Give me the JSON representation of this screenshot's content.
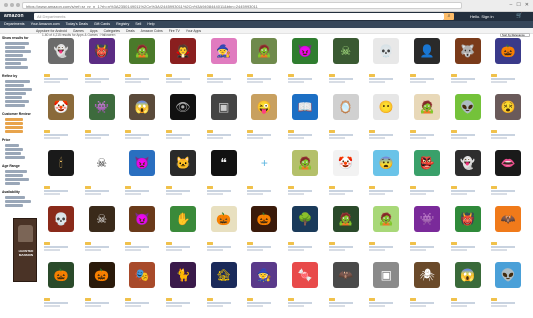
{
  "browser": {
    "url": "https://www.amazon.com/s/ref=sr_nr_n_1?rh=n%3A2350149011%2Cn%3A!2445993011%2Cn%3A9408444011&bbn=2445993011",
    "controls": [
      "–",
      "☐",
      "✕"
    ]
  },
  "header": {
    "logo": "amazon",
    "search_placeholder": "All Departments",
    "search_icon": "search-icon",
    "account": "Hello. Sign in",
    "cart_icon": "cart-icon",
    "cart_glyph": "🛒"
  },
  "nav": [
    "Departments",
    "Your Amazon.com",
    "Today's Deals",
    "Gift Cards",
    "Registry",
    "Sell",
    "Help"
  ],
  "subnav": [
    "Appstore for Android",
    "Games",
    "Apps",
    "Categories",
    "Deals",
    "Amazon Coins",
    "Fire TV",
    "Your Apps"
  ],
  "sidebar": {
    "headings": [
      "Show results for",
      "Refine by",
      "Customer Review",
      "Price",
      "Age Range",
      "Availability"
    ]
  },
  "promo": {
    "text": "HAUNTED MANSION"
  },
  "results": {
    "count": "1-60 of 4,215 results for Apps & Games : Halloween",
    "sort": "Sort by Relevance"
  },
  "colors": {
    "nav_dark": "#232f3e",
    "nav_mid": "#37475a",
    "search_button": "#febd69",
    "link": "#1a5db5"
  },
  "apps": [
    {
      "icon_name": "ghost-icon",
      "glyph": "👻",
      "bg": "#6b6b6b",
      "fg": "#ffffff"
    },
    {
      "icon_name": "monster-icon",
      "glyph": "👹",
      "bg": "#5b2c83",
      "fg": "#ffdd55"
    },
    {
      "icon_name": "frankenstein-icon",
      "glyph": "🧟",
      "bg": "#4a7a2a",
      "fg": "#cfeec0"
    },
    {
      "icon_name": "vampire-icon",
      "glyph": "🧛",
      "bg": "#8a1f1f",
      "fg": "#ffffff"
    },
    {
      "icon_name": "witch-icon",
      "glyph": "🧙",
      "bg": "#e07bbf",
      "fg": "#222222"
    },
    {
      "icon_name": "zombie-icon",
      "glyph": "🧟",
      "bg": "#6f8a4c",
      "fg": "#ffffff"
    },
    {
      "icon_name": "monster-face-icon",
      "glyph": "😈",
      "bg": "#2f7d2f",
      "fg": "#ffe066"
    },
    {
      "icon_name": "frankenstein-face-icon",
      "glyph": "☠",
      "bg": "#3a5a32",
      "fg": "#b4f08a"
    },
    {
      "icon_name": "skull-portrait-icon",
      "glyph": "💀",
      "bg": "#e8e8e8",
      "fg": "#222222"
    },
    {
      "icon_name": "ghost-shadow-icon",
      "glyph": "👤",
      "bg": "#2a2a2a",
      "fg": "#bbbbbb"
    },
    {
      "icon_name": "werewolf-icon",
      "glyph": "🐺",
      "bg": "#7a3b1a",
      "fg": "#ffd9a0"
    },
    {
      "icon_name": "pumpkin-field-icon",
      "glyph": "🎃",
      "bg": "#3a3a8a",
      "fg": "#ffb000"
    },
    {
      "icon_name": "scarecrow-icon",
      "glyph": "🤡",
      "bg": "#8a6a3a",
      "fg": "#ffffff"
    },
    {
      "icon_name": "creature-icon",
      "glyph": "👾",
      "bg": "#3d6b3d",
      "fg": "#ffffff"
    },
    {
      "icon_name": "haunted-man-icon",
      "glyph": "😱",
      "bg": "#5a4a3a",
      "fg": "#ffffff"
    },
    {
      "icon_name": "dark-figure-icon",
      "glyph": "👁",
      "bg": "#111111",
      "fg": "#aaaaaa"
    },
    {
      "icon_name": "photo-frame-icon",
      "glyph": "▣",
      "bg": "#444444",
      "fg": "#cccccc"
    },
    {
      "icon_name": "cartoon-face-icon",
      "glyph": "😜",
      "bg": "#c8a060",
      "fg": "#333333"
    },
    {
      "icon_name": "book-icon",
      "glyph": "📖",
      "bg": "#1c6fc4",
      "fg": "#ffffff"
    },
    {
      "icon_name": "mirror-icon",
      "glyph": "🪞",
      "bg": "#d0d0d0",
      "fg": "#555555"
    },
    {
      "icon_name": "face-icon",
      "glyph": "😶",
      "bg": "#e6e6e6",
      "fg": "#444444"
    },
    {
      "icon_name": "mummy-icon",
      "glyph": "🧟",
      "bg": "#e8d8b8",
      "fg": "#555555"
    },
    {
      "icon_name": "cartoon-monster-icon",
      "glyph": "👽",
      "bg": "#74c23a",
      "fg": "#ffffff"
    },
    {
      "icon_name": "ghoul-icon",
      "glyph": "😵",
      "bg": "#6a5a5a",
      "fg": "#ffffff"
    },
    {
      "icon_name": "candle-icon",
      "glyph": "🕯",
      "bg": "#1a1a1a",
      "fg": "#ffcc66"
    },
    {
      "icon_name": "skull-icon",
      "glyph": "☠",
      "bg": "#ffffff",
      "fg": "#222222"
    },
    {
      "icon_name": "blue-monster-icon",
      "glyph": "👿",
      "bg": "#2a6fc0",
      "fg": "#ffffff"
    },
    {
      "icon_name": "cat-icon",
      "glyph": "🐱",
      "bg": "#2a2a2a",
      "fg": "#ff9900"
    },
    {
      "icon_name": "quote-text-icon",
      "glyph": "❝",
      "bg": "#111111",
      "fg": "#eeeeee"
    },
    {
      "icon_name": "plus-icon",
      "glyph": "+",
      "bg": "#ffffff",
      "fg": "#5cb6e0"
    },
    {
      "icon_name": "zombie-cartoon-icon",
      "glyph": "🧟",
      "bg": "#b4c06a",
      "fg": "#333333"
    },
    {
      "icon_name": "clown-icon",
      "glyph": "🤡",
      "bg": "#f2f2f2",
      "fg": "#d24a4a"
    },
    {
      "icon_name": "spooky-face-icon",
      "glyph": "😨",
      "bg": "#6ac3e8",
      "fg": "#ffffff"
    },
    {
      "icon_name": "green-ghoul-icon",
      "glyph": "👺",
      "bg": "#3aa06a",
      "fg": "#ffffff"
    },
    {
      "icon_name": "sticker-monster-icon",
      "glyph": "👻",
      "bg": "#2d2d2d",
      "fg": "#ffffff"
    },
    {
      "icon_name": "lips-icon",
      "glyph": "👄",
      "bg": "#1a1a1a",
      "fg": "#ff3344"
    },
    {
      "icon_name": "skull-red-icon",
      "glyph": "💀",
      "bg": "#8a2a1a",
      "fg": "#ffddaa"
    },
    {
      "icon_name": "skull-dark-icon",
      "glyph": "☠",
      "bg": "#3a2a1a",
      "fg": "#eeeeee"
    },
    {
      "icon_name": "demon-face-icon",
      "glyph": "😈",
      "bg": "#6a3a1a",
      "fg": "#ffcc88"
    },
    {
      "icon_name": "hand-icon",
      "glyph": "✋",
      "bg": "#3a8a3a",
      "fg": "#ffffff"
    },
    {
      "icon_name": "pumpkin-cartoon-icon",
      "glyph": "🎃",
      "bg": "#e8e0c0",
      "fg": "#e07000"
    },
    {
      "icon_name": "jack-o-lantern-icon",
      "glyph": "🎃",
      "bg": "#3a1a0a",
      "fg": "#ff8800"
    },
    {
      "icon_name": "tree-icon",
      "glyph": "🌳",
      "bg": "#1a3a5a",
      "fg": "#aaddaa"
    },
    {
      "icon_name": "frankenstein-green-icon",
      "glyph": "🧟",
      "bg": "#2a4a2a",
      "fg": "#9ee07a"
    },
    {
      "icon_name": "cartoon-zombie-icon",
      "glyph": "🧟",
      "bg": "#a8d878",
      "fg": "#333333"
    },
    {
      "icon_name": "purple-monster-icon",
      "glyph": "👾",
      "bg": "#7a2a9a",
      "fg": "#ffffff"
    },
    {
      "icon_name": "green-monster-icon",
      "glyph": "👹",
      "bg": "#2f8a3a",
      "fg": "#ffffff"
    },
    {
      "icon_name": "orange-creature-icon",
      "glyph": "🦇",
      "bg": "#f07a1a",
      "fg": "#222222"
    },
    {
      "icon_name": "pumpkin-icon",
      "glyph": "🎃",
      "bg": "#2a4a2a",
      "fg": "#ff9900"
    },
    {
      "icon_name": "jack-o-lantern-glow-icon",
      "glyph": "🎃",
      "bg": "#2a1a0a",
      "fg": "#ffaa00"
    },
    {
      "icon_name": "mask-icon",
      "glyph": "🎭",
      "bg": "#a84a2a",
      "fg": "#ffffff"
    },
    {
      "icon_name": "black-cat-icon",
      "glyph": "🐈",
      "bg": "#3a1a4a",
      "fg": "#ffaa00"
    },
    {
      "icon_name": "haunted-house-icon",
      "glyph": "🏚",
      "bg": "#1a2a5a",
      "fg": "#ffcc00"
    },
    {
      "icon_name": "witch-hat-icon",
      "glyph": "🧙",
      "bg": "#5a3a8a",
      "fg": "#ffcc44"
    },
    {
      "icon_name": "candy-icon",
      "glyph": "🍬",
      "bg": "#e84a4a",
      "fg": "#ffffff"
    },
    {
      "icon_name": "bat-icon",
      "glyph": "🦇",
      "bg": "#4a4a4a",
      "fg": "#ffffff"
    },
    {
      "icon_name": "photo-icon",
      "glyph": "▣",
      "bg": "#8a8a8a",
      "fg": "#ffffff"
    },
    {
      "icon_name": "spider-icon",
      "glyph": "🕷",
      "bg": "#6a4a2a",
      "fg": "#ffffff"
    },
    {
      "icon_name": "scary-face-icon",
      "glyph": "😱",
      "bg": "#3a6a3a",
      "fg": "#ffffff"
    },
    {
      "icon_name": "monster-round-icon",
      "glyph": "👽",
      "bg": "#4aa0d8",
      "fg": "#ffffff"
    }
  ]
}
